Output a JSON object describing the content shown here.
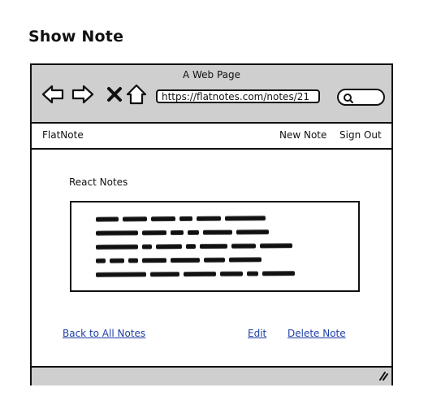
{
  "page": {
    "heading": "Show Note"
  },
  "browser": {
    "window_title": "A Web Page",
    "url": "https://flatnotes.com/notes/21",
    "icons": {
      "back": "arrow-left-icon",
      "forward": "arrow-right-icon",
      "stop": "close-icon",
      "home": "home-icon",
      "search": "search-icon",
      "resize": "resize-grip-icon"
    },
    "chrome_color": "#cfcfcf"
  },
  "navbar": {
    "brand": "FlatNote",
    "new_note": "New Note",
    "sign_out": "Sign Out"
  },
  "note": {
    "title": "React Notes",
    "body_placeholder": "scribble text lines (illegible placeholder content)"
  },
  "actions": {
    "back_to_all": "Back to All Notes",
    "edit": "Edit",
    "delete": "Delete Note",
    "link_color": "#1f3fa8"
  }
}
